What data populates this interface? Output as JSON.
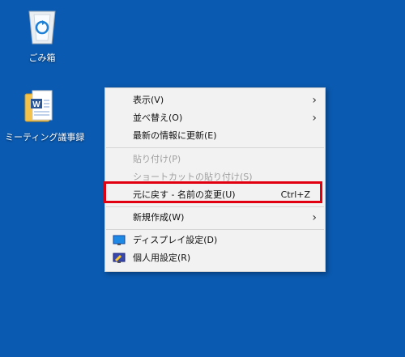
{
  "desktop": {
    "recycle_bin_label": "ごみ箱",
    "document_label": "ミーティング議事録"
  },
  "context_menu": {
    "items": [
      {
        "label": "表示(V)",
        "submenu": true
      },
      {
        "label": "並べ替え(O)",
        "submenu": true
      },
      {
        "label": "最新の情報に更新(E)"
      },
      {
        "label": "貼り付け(P)",
        "disabled": true
      },
      {
        "label": "ショートカットの貼り付け(S)",
        "disabled": true
      },
      {
        "label": "元に戻す - 名前の変更(U)",
        "shortcut": "Ctrl+Z"
      },
      {
        "label": "新規作成(W)",
        "submenu": true
      },
      {
        "label": "ディスプレイ設定(D)",
        "icon": "display-icon"
      },
      {
        "label": "個人用設定(R)",
        "icon": "personalize-icon"
      }
    ]
  },
  "colors": {
    "desktop_bg": "#0a5ab1",
    "highlight_border": "#e00010"
  }
}
